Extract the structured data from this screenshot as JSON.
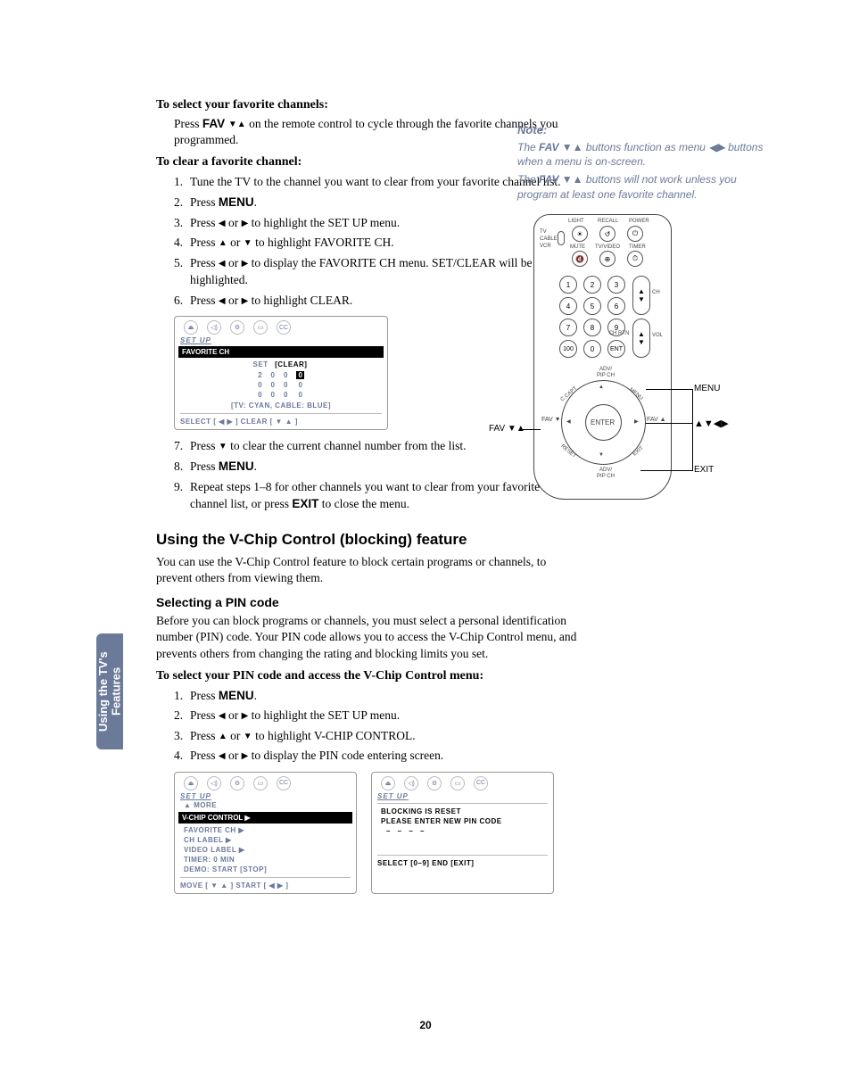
{
  "page_number": "20",
  "sidebar_tab": "Using the TV's Features",
  "h1_select_fav": "To select your favorite channels:",
  "p_select_fav_a": "Press ",
  "p_select_fav_b": " on the remote control to cycle through the favorite channels you programmed.",
  "fav_label": "FAV ",
  "h1_clear_fav": "To clear a favorite channel:",
  "steps_clear": [
    "Tune the TV to the channel you want to clear from your favorite channel list.",
    "Press MENU.",
    "Press ◀ or ▶ to highlight the SET UP menu.",
    "Press ▲ or ▼ to highlight FAVORITE CH.",
    "Press ◀ or ▶ to display the FAVORITE CH menu. SET/CLEAR will be highlighted.",
    "Press ◀ or ▶ to highlight CLEAR."
  ],
  "steps_clear_after": [
    "Press ▼ to clear the current channel number from the list.",
    "Press MENU.",
    "Repeat steps 1–8 for other channels you want to clear from your favorite channel list, or press EXIT to close the menu."
  ],
  "note_head": "Note:",
  "note1_a": "The ",
  "note1_b": " buttons function as menu ◀▶ buttons when a menu is on-screen.",
  "note2_a": "The ",
  "note2_b": " buttons will not work unless you program at least one favorite channel.",
  "sect_vchip": "Using the V-Chip Control (blocking) feature",
  "p_vchip_intro": "You can use the V-Chip Control feature to block certain programs or channels, to prevent others from viewing them.",
  "subsect_pin": "Selecting a PIN code",
  "p_pin": "Before you can block programs or channels, you must select a personal identification number (PIN) code. Your PIN code allows you to access the V-Chip Control menu, and prevents others from changing the rating and blocking limits you set.",
  "h1_pin_steps": "To select your PIN code and access the V-Chip Control menu:",
  "steps_pin": [
    "Press MENU.",
    "Press ◀ or ▶ to highlight the SET UP menu.",
    "Press ▲ or ▼ to highlight V-CHIP CONTROL.",
    "Press ◀ or ▶ to display the PIN code entering screen."
  ],
  "osd1": {
    "setup": "SET UP",
    "bar": "FAVORITE CH",
    "row1": "SET  [CLEAR]",
    "grid_r1": [
      "2",
      "0",
      "0",
      "0"
    ],
    "grid_r2": [
      "0",
      "0",
      "0",
      "0"
    ],
    "grid_r3": [
      "0",
      "0",
      "0",
      "0"
    ],
    "row5": "[TV: CYAN,  CABLE: BLUE]",
    "footer": "SELECT [ ◀  ▶ ]    CLEAR [ ▼  ▲ ]"
  },
  "osd2a": {
    "setup": "SET UP",
    "more": "▲ MORE",
    "bar": "V-CHIP CONTROL      ▶",
    "rows": [
      "FAVORITE CH            ▶",
      "CH LABEL               ▶",
      "VIDEO LABEL            ▶",
      "TIMER:              0 MIN",
      "DEMO:          START [STOP]"
    ],
    "footer": "MOVE [ ▼  ▲ ]     START [ ◀  ▶ ]"
  },
  "osd2b": {
    "setup": "SET UP",
    "row1": "BLOCKING IS RESET",
    "row2": "PLEASE ENTER NEW PIN CODE",
    "dashes": "–  –  –  –",
    "footer": "SELECT [0–9]   END [EXIT]"
  },
  "remote": {
    "top_labels": [
      "LIGHT",
      "RECALL",
      "POWER"
    ],
    "side_labels": [
      "TV",
      "CABLE",
      "VCR"
    ],
    "mid_labels": [
      "MUTE",
      "TV/VIDEO",
      "TIMER"
    ],
    "numpad": [
      "1",
      "2",
      "3",
      "4",
      "5",
      "6",
      "7",
      "8",
      "9",
      "100",
      "0",
      "ENT"
    ],
    "ch": "CH",
    "vol": "VOL",
    "chrtn": "CH RTN",
    "adv": "ADV/",
    "pip": "PIP CH",
    "ccapt": "C.CAPT",
    "menu": "MENU",
    "enter": "ENTER",
    "fav": "FAV",
    "reset": "RESET",
    "exit": "EXIT"
  },
  "callouts": {
    "fav": "FAV ▼▲",
    "menu": "MENU",
    "arrows": "▲▼◀▶",
    "exit": "EXIT"
  }
}
